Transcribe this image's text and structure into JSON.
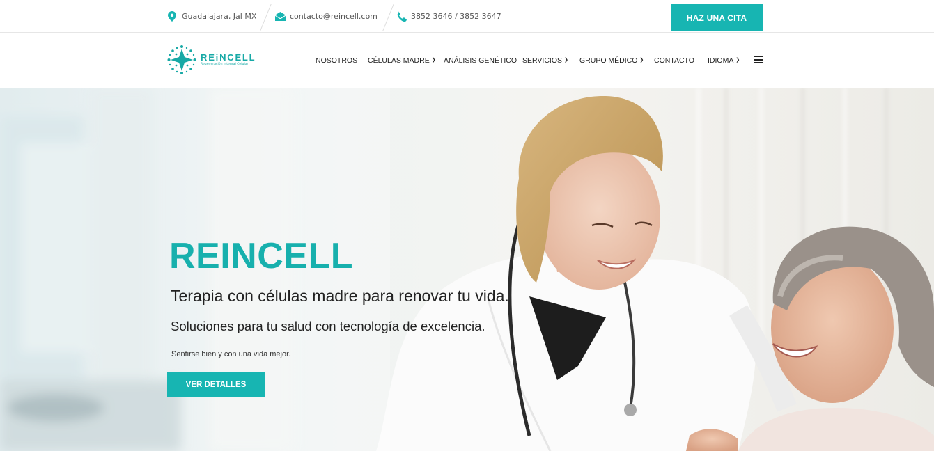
{
  "topbar": {
    "location": {
      "icon": "map-pin-icon",
      "text": "Guadalajara, Jal MX"
    },
    "email": {
      "icon": "envelope-icon",
      "text": "contacto@reincell.com"
    },
    "phone": {
      "icon": "phone-icon",
      "text": "3852 3646 / 3852 3647"
    },
    "cta_label": "HAZ UNA CITA"
  },
  "logo": {
    "name": "REiNCELL",
    "tagline": "Regeneración Integral Celular"
  },
  "nav": {
    "items": [
      {
        "label": "NOSOTROS",
        "dropdown": false
      },
      {
        "label": "CÉLULAS MADRE",
        "dropdown": true
      },
      {
        "label": "ANÁLISIS GENÉTICO",
        "dropdown": false
      },
      {
        "label": "SERVICIOS",
        "dropdown": true
      },
      {
        "label": "GRUPO MÉDICO",
        "dropdown": true
      },
      {
        "label": "CONTACTO",
        "dropdown": false
      },
      {
        "label": "IDIOMA",
        "dropdown": true
      }
    ],
    "menu_icon": "hamburger-menu-icon"
  },
  "hero": {
    "title": "REINCELL",
    "line1": "Terapia con células madre para renovar tu vida.",
    "line2": "Soluciones para tu salud con tecnología de excelencia.",
    "line3": "Sentirse bien y con una vida mejor.",
    "cta_label": "VER DETALLES"
  },
  "colors": {
    "accent": "#17b5b2",
    "text_dark": "#222222"
  }
}
